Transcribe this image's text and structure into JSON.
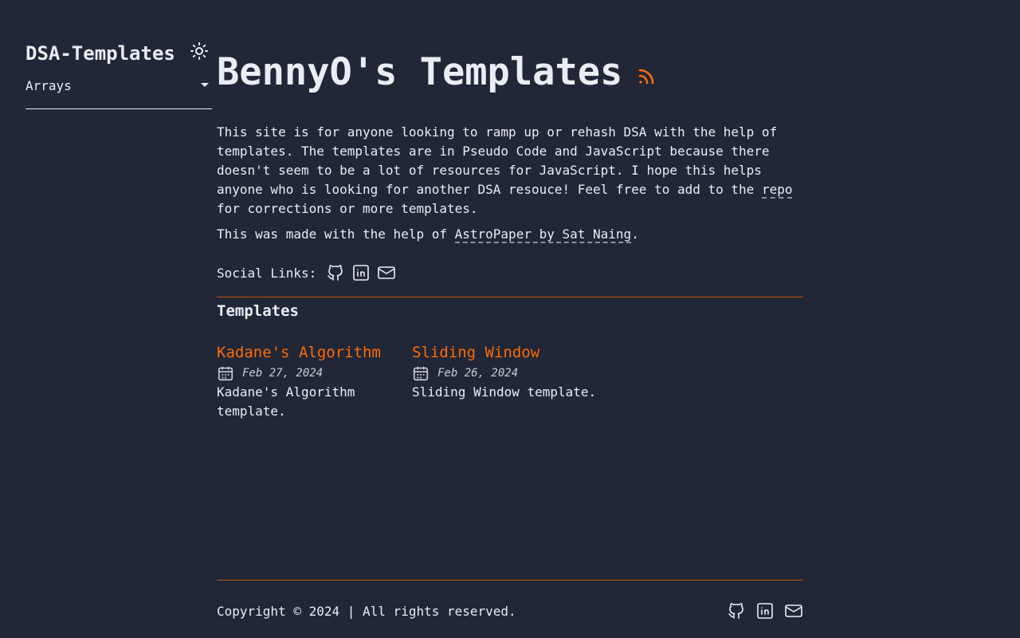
{
  "sidebar": {
    "site_title": "DSA-Templates",
    "theme_icon": "sun-icon",
    "nav_selected": "Arrays"
  },
  "hero": {
    "title": "BennyO's Templates",
    "rss_icon": "rss-icon"
  },
  "intro": {
    "paragraph1_before_link": "This site is for anyone looking to ramp up or rehash DSA with the help of templates. The templates are in Pseudo Code and JavaScript because there doesn't seem to be a lot of resources for JavaScript. I hope this helps anyone who is looking for another DSA resouce! Feel free to add to the ",
    "repo_link": "repo",
    "paragraph1_after_link": " for corrections or more templates.",
    "paragraph2_before_link": "This was made with the help of ",
    "astropaper_link": "AstroPaper by Sat Naing",
    "paragraph2_after_link": "."
  },
  "social": {
    "label": "Social Links:",
    "icons": [
      "github-icon",
      "linkedin-icon",
      "mail-icon"
    ]
  },
  "templates": {
    "section_title": "Templates",
    "items": [
      {
        "title": "Kadane's Algorithm",
        "date": "Feb 27, 2024",
        "description": "Kadane's Algorithm template."
      },
      {
        "title": "Sliding Window",
        "date": "Feb 26, 2024",
        "description": "Sliding Window template."
      }
    ]
  },
  "footer": {
    "copyright": "Copyright © 2024 | All rights reserved."
  },
  "colors": {
    "background": "#212737",
    "text": "#eaedf3",
    "accent": "#ff6b01",
    "divider": "#c2510f"
  }
}
